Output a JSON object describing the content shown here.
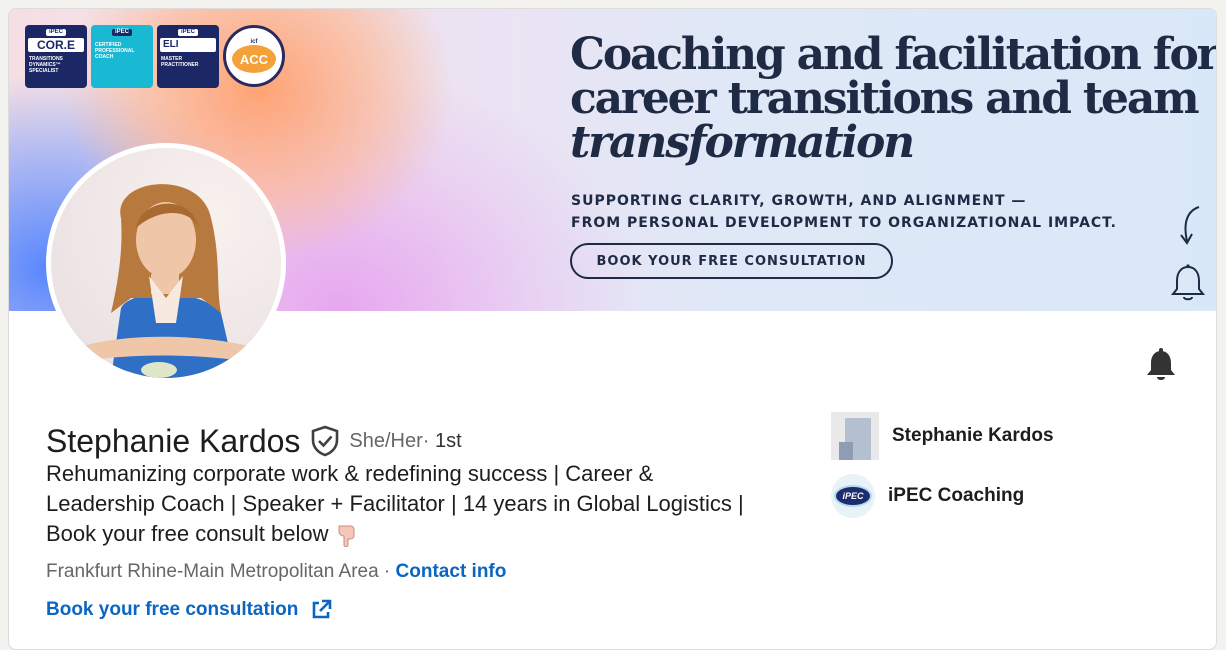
{
  "banner": {
    "badges": [
      {
        "logo": "iPEC",
        "title": "COR.E",
        "caption": "TRANSITIONS DYNAMICS™ SPECIALIST"
      },
      {
        "logo": "iPEC",
        "title": "",
        "caption": "CERTIFIED PROFESSIONAL COACH"
      },
      {
        "logo": "iPEC",
        "title": "ELI",
        "caption": "MASTER PRACTITIONER"
      },
      {
        "logo": "icf",
        "title": "ACC",
        "caption": ""
      }
    ],
    "headline_line1": "Coaching and facilitation for",
    "headline_line2": "career transitions and team",
    "headline_line3": "transformation",
    "subline_1": "SUPPORTING CLARITY, GROWTH, AND ALIGNMENT —",
    "subline_2": "FROM PERSONAL DEVELOPMENT TO ORGANIZATIONAL IMPACT.",
    "cta_label": "BOOK YOUR FREE CONSULTATION"
  },
  "profile": {
    "name": "Stephanie Kardos",
    "pronouns": "She/Her",
    "separator": " · ",
    "degree": "1st",
    "headline_line1": "Rehumanizing corporate work & redefining success | Career &",
    "headline_line2": "Leadership Coach | Speaker + Facilitator | 14 years in Global Logistics |",
    "headline_line3": "Book your free consult below",
    "location": "Frankfurt Rhine-Main Metropolitan Area",
    "contact_label": "Contact info",
    "website_label": "Book your free consultation"
  },
  "side": {
    "company_label": "Stephanie Kardos",
    "school_label": "iPEC Coaching",
    "school_logo_text": "iPEC"
  },
  "icons": {
    "verified": "shield-check-icon",
    "notify": "bell-icon",
    "external": "external-link-icon"
  },
  "colors": {
    "link": "#0a66c2",
    "headline_ink": "#1f2a44"
  }
}
